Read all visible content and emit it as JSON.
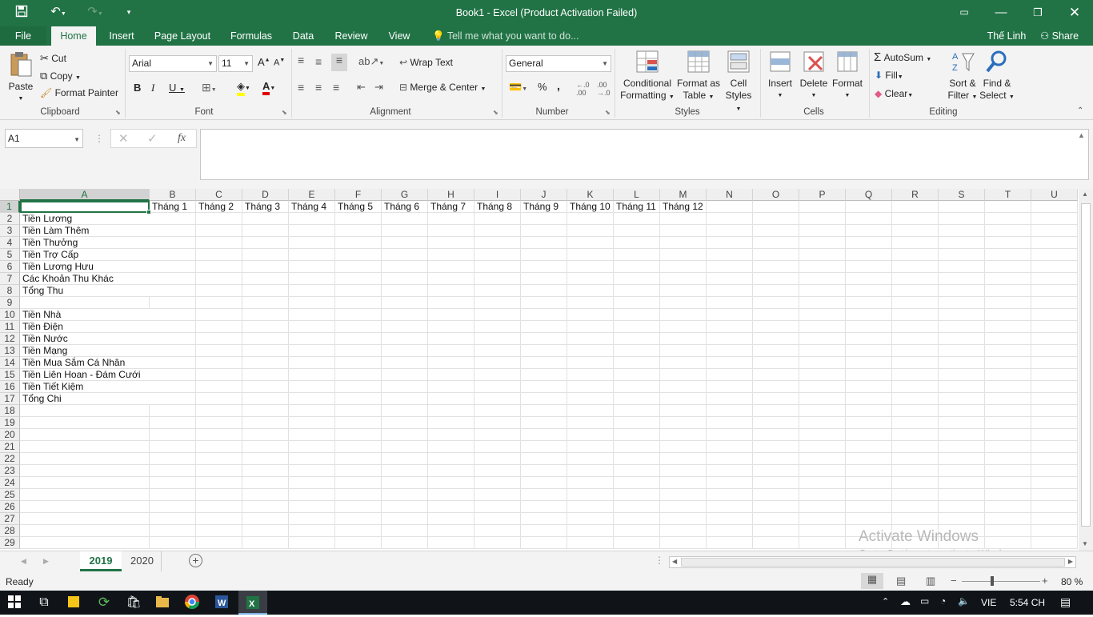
{
  "window": {
    "title": "Book1 - Excel (Product Activation Failed)"
  },
  "tabs": [
    "File",
    "Home",
    "Insert",
    "Page Layout",
    "Formulas",
    "Data",
    "Review",
    "View"
  ],
  "tell_me": "Tell me what you want to do...",
  "user": "Thế Linh",
  "share": "Share",
  "ribbon": {
    "paste": "Paste",
    "cut": "Cut",
    "copy": "Copy",
    "format_painter": "Format Painter",
    "clipboard": "Clipboard",
    "font_name": "Arial",
    "font_size": "11",
    "font": "Font",
    "bold": "B",
    "italic": "I",
    "underline": "U",
    "wrap_text": "Wrap Text",
    "merge_center": "Merge & Center",
    "alignment": "Alignment",
    "number_format": "General",
    "number": "Number",
    "percent": "%",
    "comma": ",",
    "cond_fmt_1": "Conditional",
    "cond_fmt_2": "Formatting",
    "fmt_table_1": "Format as",
    "fmt_table_2": "Table",
    "cell_styles_1": "Cell",
    "cell_styles_2": "Styles",
    "styles": "Styles",
    "insert": "Insert",
    "delete": "Delete",
    "format": "Format",
    "cells": "Cells",
    "autosum": "AutoSum",
    "fill": "Fill",
    "clear": "Clear",
    "sort_1": "Sort &",
    "sort_2": "Filter",
    "find_1": "Find &",
    "find_2": "Select",
    "editing": "Editing"
  },
  "formula_bar": {
    "name_box": "A1",
    "fx": "fx",
    "content": ""
  },
  "columns": [
    "A",
    "B",
    "C",
    "D",
    "E",
    "F",
    "G",
    "H",
    "I",
    "J",
    "K",
    "L",
    "M",
    "N",
    "O",
    "P",
    "Q",
    "R",
    "S",
    "T",
    "U"
  ],
  "rows": [
    "1",
    "2",
    "3",
    "4",
    "5",
    "6",
    "7",
    "8",
    "9",
    "10",
    "11",
    "12",
    "13",
    "14",
    "15",
    "16",
    "17",
    "18",
    "19",
    "20",
    "21",
    "22",
    "23",
    "24",
    "25",
    "26",
    "27",
    "28",
    "29"
  ],
  "header_row": [
    "Tháng 1",
    "Tháng 2",
    "Tháng 3",
    "Tháng 4",
    "Tháng 5",
    "Tháng 6",
    "Tháng 7",
    "Tháng 8",
    "Tháng 9",
    "Tháng 10",
    "Tháng 11",
    "Tháng 12"
  ],
  "col_a": [
    "",
    "Tiền Lương",
    "Tiền Làm Thêm",
    "Tiền Thưởng",
    "Tiền Trợ Cấp",
    "Tiền Lương Hưu",
    "Các Khoản Thu Khác",
    "Tổng Thu",
    "",
    "Tiền Nhà",
    "Tiền Điện",
    "Tiền Nước",
    "Tiền Mạng",
    "Tiền Mua Sắm Cá Nhân",
    "Tiền Liên Hoan - Đám Cưới",
    "Tiền Tiết Kiệm",
    "Tổng Chi"
  ],
  "sheets": [
    "2019",
    "2020"
  ],
  "status": {
    "ready": "Ready",
    "zoom": "80 %"
  },
  "watermark": {
    "line1": "Activate Windows",
    "line2": "Go to Settings to activate Windows."
  },
  "taskbar": {
    "lang": "VIE",
    "time": "5:54 CH"
  },
  "colors": {
    "accent": "#217346"
  }
}
